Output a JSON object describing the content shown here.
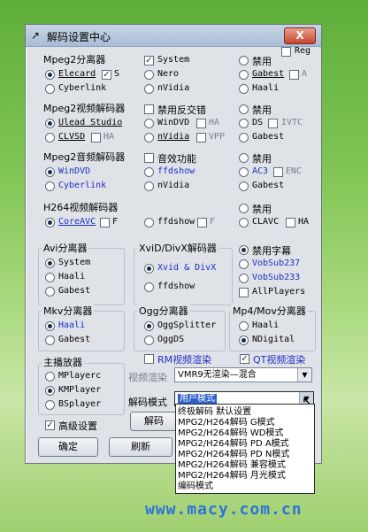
{
  "window": {
    "title": "解码设置中心",
    "close_label": "X"
  },
  "mpeg2_splitter": {
    "label": "Mpeg2分离器",
    "col1": [
      "Elecard",
      "Cyberlink"
    ],
    "s_label": "S",
    "col2": [
      "System",
      "Nero",
      "nVidia"
    ],
    "col3": [
      "禁用",
      "Gabest",
      "Haali"
    ],
    "reg_label": "Reg",
    "a_label": "A"
  },
  "mpeg2_video": {
    "label": "Mpeg2视频解码器",
    "col1": [
      "Ulead Studio",
      "CLVSD"
    ],
    "ha1_label": "HA",
    "col2": [
      "禁用反交错",
      "WinDVD",
      "nVidia"
    ],
    "ha2_label": "HA",
    "vpp_label": "VPP",
    "col3": [
      "禁用",
      "DS",
      "Gabest"
    ],
    "ivtc_label": "IVTC"
  },
  "mpeg2_audio": {
    "label": "Mpeg2音频解码器",
    "col1": [
      "WinDVD",
      "Cyberlink"
    ],
    "col2": [
      "音效功能",
      "ffdshow",
      "nVidia"
    ],
    "col3": [
      "禁用",
      "AC3",
      "Gabest"
    ],
    "enc_label": "ENC"
  },
  "h264_video": {
    "label": "H264视频解码器",
    "col1": [
      "CoreAVC"
    ],
    "f1_label": "F",
    "col2": [
      "ffdshow"
    ],
    "f2_label": "F",
    "col3": [
      "禁用",
      "CLAVC"
    ],
    "ha_label": "HA"
  },
  "avi_splitter": {
    "label": "Avi分离器",
    "items": [
      "System",
      "Haali",
      "Gabest"
    ]
  },
  "xvid_decoder": {
    "label": "XviD/DivX解码器",
    "items": [
      "Xvid & DivX",
      "ffdshow"
    ]
  },
  "subtitle": {
    "items": [
      "禁用字幕",
      "VobSub237",
      "VobSub233"
    ],
    "allplayers_label": "AllPlayers"
  },
  "mkv_splitter": {
    "label": "Mkv分离器",
    "items": [
      "Haali",
      "Gabest"
    ]
  },
  "ogg_splitter": {
    "label": "Ogg分离器",
    "items": [
      "OggSplitter",
      "OggDS"
    ]
  },
  "mp4_splitter": {
    "label": "Mp4/Mov分离器",
    "items": [
      "Haali",
      "NDigital"
    ]
  },
  "player": {
    "label": "主播放器",
    "items": [
      "MPlayerc",
      "KMPlayer",
      "BSplayer"
    ],
    "advanced_label": "高级设置"
  },
  "rm_render": {
    "label": "RM视频渲染"
  },
  "qt_render": {
    "label": "QT视频渲染"
  },
  "video_render": {
    "label": "视频渲染",
    "value": "VMR9无渲染—混合"
  },
  "decode_mode": {
    "label": "解码模式",
    "value": "用户模式"
  },
  "partial_button": {
    "label": "解码"
  },
  "buttons": {
    "ok": "确定",
    "refresh": "刷新"
  },
  "dropdown_items": [
    "终极解码 默认设置",
    "MPG2/H264解码 G模式",
    "MPG2/H264解码 WD模式",
    "MPG2/H264解码 PD A模式",
    "MPG2/H264解码 PD N模式",
    "MPG2/H264解码 兼容模式",
    "MPG2/H264解码 月光模式",
    "编码模式"
  ],
  "watermark": "www.macy.com.cn",
  "colors": {
    "link_blue": "#1d2dc3",
    "selection_blue": "#2e61c9",
    "watermark_blue": "#2f72d9"
  }
}
